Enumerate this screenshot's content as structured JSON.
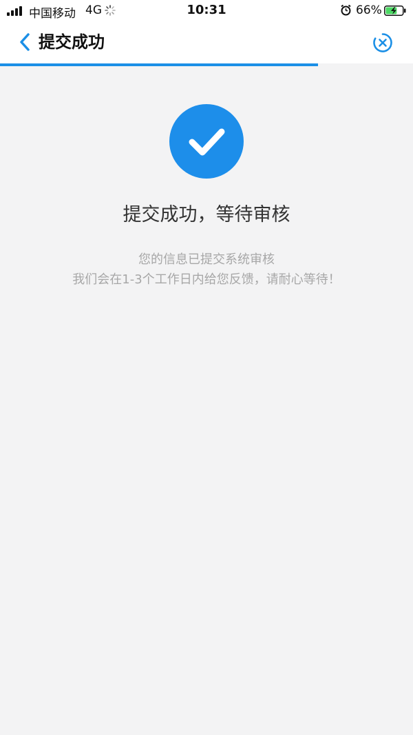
{
  "status_bar": {
    "carrier": "中国移动",
    "network": "4G",
    "time": "10:31",
    "battery_percent": "66%",
    "battery_level": 0.66,
    "icons": [
      "signal-icon",
      "loading-spinner-icon",
      "alarm-icon",
      "battery-charging-icon"
    ]
  },
  "nav": {
    "title": "提交成功",
    "back_icon": "chevron-left-icon",
    "close_icon": "close-circle-icon",
    "load_progress": 0.77
  },
  "result": {
    "icon": "check-circle-icon",
    "title": "提交成功，等待审核",
    "line1": "您的信息已提交系统审核",
    "line2": "我们会在1-3个工作日内给您反馈，请耐心等待！"
  },
  "colors": {
    "accent": "#1d8eea",
    "background": "#f3f3f4",
    "muted_text": "#a7a7a7"
  }
}
